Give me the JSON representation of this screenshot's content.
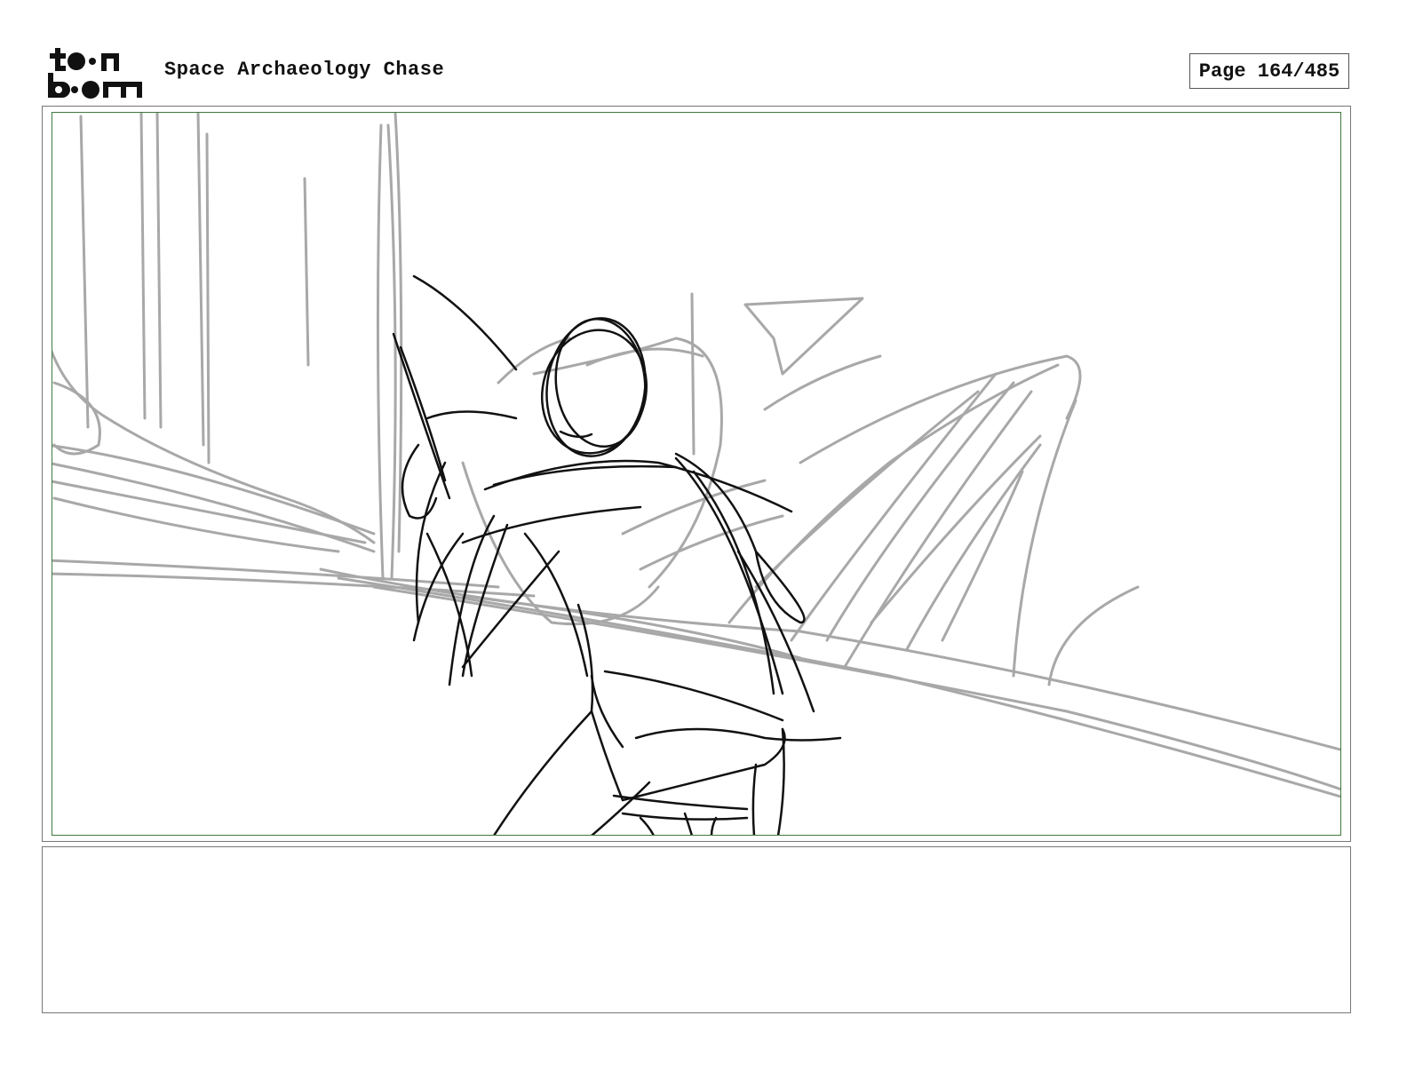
{
  "header": {
    "logo_text": "toon boom",
    "project_title": "Space Archaeology Chase",
    "page_label": "Page 164/485"
  },
  "panel": {
    "image_description_icon": "sketch-image"
  },
  "notes": {
    "text": ""
  },
  "colors": {
    "frame_border": "#777777",
    "safe_area_border": "#3f7a3f",
    "sketch_background": "#a8a8a8",
    "sketch_foreground": "#111111"
  }
}
